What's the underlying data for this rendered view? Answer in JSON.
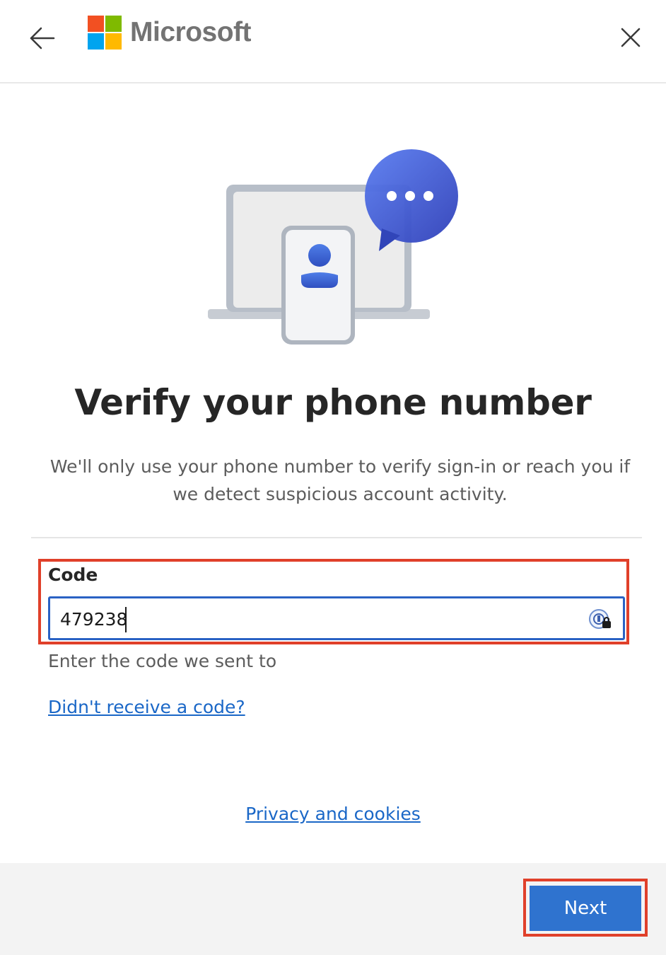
{
  "header": {
    "brand_name": "Microsoft",
    "logo_colors": [
      "#f25022",
      "#7fba00",
      "#00a4ef",
      "#ffb900"
    ],
    "back_icon": "arrow-left-icon",
    "close_icon": "close-icon"
  },
  "illustration": {
    "name": "laptop-phone-chat-illustration"
  },
  "main": {
    "title": "Verify your phone number",
    "description": "We'll only use your phone number to verify sign-in or reach you if we detect suspicious account activity."
  },
  "code_field": {
    "label": "Code",
    "value": "479238",
    "hint": "Enter the code we sent to",
    "password_manager_icon": "password-manager-icon"
  },
  "links": {
    "resend": "Didn't receive a code?",
    "privacy": "Privacy and cookies"
  },
  "footer": {
    "next_label": "Next"
  },
  "colors": {
    "accent": "#2f73cf",
    "link": "#1a67c7",
    "highlight": "#e0402a"
  }
}
